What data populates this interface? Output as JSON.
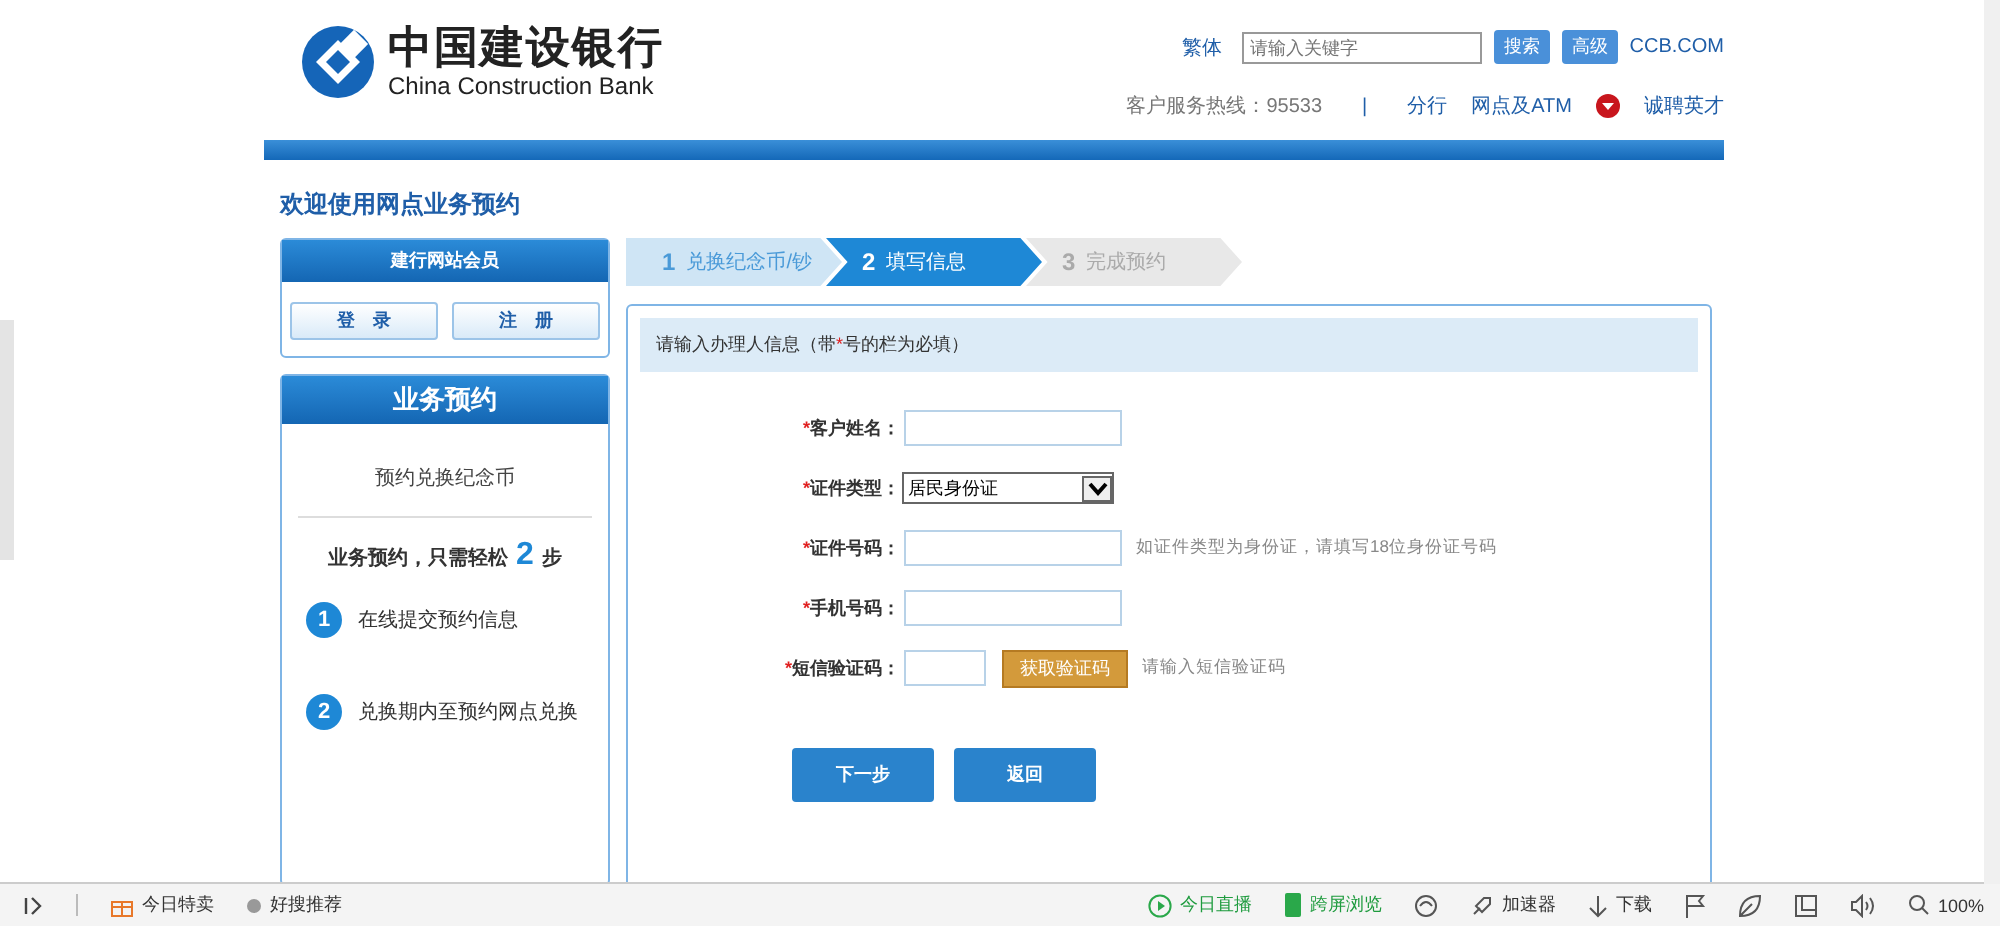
{
  "header": {
    "logo_cn": "中国建设银行",
    "logo_en": "China Construction Bank",
    "lang_link": "繁体",
    "search": {
      "placeholder": "请输入关键字"
    },
    "search_button": "搜索",
    "advanced_button": "高级",
    "site_link": "CCB.COM",
    "hotline": "客户服务热线：95533",
    "separator": "|",
    "nav": [
      {
        "label": "分行",
        "dropdown": false
      },
      {
        "label": "网点及ATM",
        "dropdown": true
      },
      {
        "label": "诚聘英才",
        "dropdown": false
      }
    ]
  },
  "page_title": "欢迎使用网点业务预约",
  "member_box": {
    "title": "建行网站会员",
    "buttons": [
      "登　录",
      "注　册"
    ]
  },
  "service_box": {
    "title": "业务预约",
    "subtitle": "预约兑换纪念币",
    "steps_intro": "业务预约，只需轻松",
    "steps_count": "2",
    "steps_unit": "步",
    "steps": [
      {
        "number": "1",
        "text": "在线提交预约信息"
      },
      {
        "number": "2",
        "text": "兑换期内至预约网点兑换"
      }
    ]
  },
  "progress": [
    {
      "number": "1",
      "label": "兑换纪念币/钞",
      "selected": false
    },
    {
      "number": "2",
      "label": "填写信息",
      "selected": true
    },
    {
      "number": "3",
      "label": "完成预约",
      "selected": false
    }
  ],
  "form": {
    "heading_before": "请输入办理人信息（带",
    "required_mark": "*",
    "heading_after": "号的栏为必填）",
    "fields": [
      {
        "label": "客户姓名：",
        "required": true,
        "kind": "text"
      },
      {
        "label": "证件类型：",
        "required": true,
        "kind": "select",
        "value": "居民身份证"
      },
      {
        "label": "证件号码：",
        "required": true,
        "kind": "text",
        "hint": "如证件类型为身份证，请填写18位身份证号码"
      },
      {
        "label": "手机号码：",
        "required": true,
        "kind": "text"
      },
      {
        "label": "短信验证码：",
        "required": true,
        "kind": "code",
        "action": "获取验证码",
        "hint": "请输入短信验证码"
      }
    ],
    "buttons": [
      "下一步",
      "返回"
    ]
  },
  "status_bar": {
    "left": [
      {
        "label": "今日特卖",
        "kind": "gift"
      },
      {
        "label": "好搜推荐",
        "kind": "dot"
      }
    ],
    "right": [
      {
        "label": "今日直播",
        "kind": "play"
      },
      {
        "label": "跨屏浏览",
        "kind": "phone"
      },
      {
        "kind": "swirl"
      },
      {
        "label": "加速器",
        "kind": "rocket"
      },
      {
        "label": "下载",
        "kind": "down"
      },
      {
        "kind": "flag"
      },
      {
        "kind": "leaf"
      },
      {
        "kind": "window"
      },
      {
        "kind": "speaker"
      },
      {
        "label": "100%",
        "kind": "zoom"
      }
    ]
  }
}
